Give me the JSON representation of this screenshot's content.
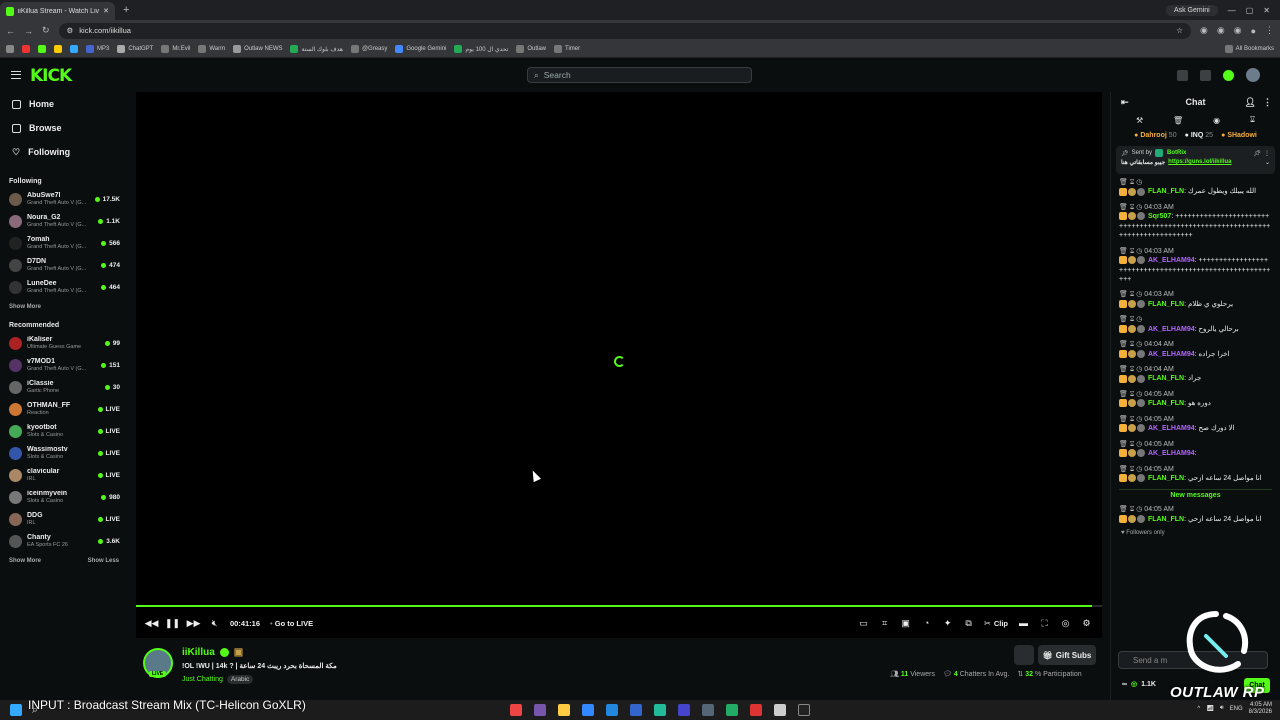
{
  "browser": {
    "tab_title": "iiKillua Stream - Watch Live on",
    "ask_gemini": "Ask Gemini",
    "url": "kick.com/iikillua",
    "bookmarks": [
      "MP3",
      "ChatGPT",
      "Mr.Evil",
      "Warm",
      "Outlaw NEWS",
      "هدف بلوك الستة",
      "@Greasy",
      "Google Gemini",
      "تحدي ال 100 يوم",
      "Outlaw",
      "Timer"
    ],
    "all_bookmarks": "All Bookmarks"
  },
  "header": {
    "logo": "KICK",
    "search_placeholder": "Search"
  },
  "sidebar": {
    "nav": [
      {
        "label": "Home",
        "icon": "home-icon"
      },
      {
        "label": "Browse",
        "icon": "browse-icon"
      },
      {
        "label": "Following",
        "icon": "heart-icon"
      }
    ],
    "following_heading": "Following",
    "following": [
      {
        "name": "AbuSwe7l",
        "category": "Grand Theft Auto V (G...",
        "viewers": "17.5K",
        "color": "#6b5a4a"
      },
      {
        "name": "Noura_G2",
        "category": "Grand Theft Auto V (G...",
        "viewers": "1.1K",
        "color": "#8a6a7a"
      },
      {
        "name": "7omah",
        "category": "Grand Theft Auto V (G...",
        "viewers": "566",
        "color": "#222222"
      },
      {
        "name": "D7DN",
        "category": "Grand Theft Auto V (G...",
        "viewers": "474",
        "color": "#444444"
      },
      {
        "name": "LuneDee",
        "category": "Grand Theft Auto V (G...",
        "viewers": "464",
        "color": "#333333"
      }
    ],
    "show_more": "Show More",
    "recommended_heading": "Recommended",
    "recommended": [
      {
        "name": "iKaliser",
        "category": "Ultimate Guess Game",
        "viewers": "99",
        "color": "#aa2222"
      },
      {
        "name": "v7MOD1",
        "category": "Grand Theft Auto V (G...",
        "viewers": "151",
        "color": "#553366"
      },
      {
        "name": "iClassie",
        "category": "Gartic Phone",
        "viewers": "30",
        "color": "#666666"
      },
      {
        "name": "OTHMAN_FF",
        "category": "Reaction",
        "viewers": "LIVE",
        "color": "#cc7733"
      },
      {
        "name": "kyootbot",
        "category": "Slots & Casino",
        "viewers": "LIVE",
        "color": "#44aa55"
      },
      {
        "name": "Wassimostv",
        "category": "Slots & Casino",
        "viewers": "LIVE",
        "color": "#3355aa"
      },
      {
        "name": "clavicular",
        "category": "IRL",
        "viewers": "LIVE",
        "color": "#aa8866"
      },
      {
        "name": "iceinmyvein",
        "category": "Slots & Casino",
        "viewers": "980",
        "color": "#777777"
      },
      {
        "name": "DDG",
        "category": "IRL",
        "viewers": "LIVE",
        "color": "#886655"
      },
      {
        "name": "Chanty",
        "category": "EA Sports FC 26",
        "viewers": "3.6K",
        "color": "#555555"
      }
    ],
    "show_less": "Show Less"
  },
  "player": {
    "progress": 0.99,
    "time": "00:41:16",
    "go_live": "Go to LIVE",
    "clip": "Clip"
  },
  "stream": {
    "streamer": "iiKillua",
    "live_badge": "LIVE",
    "title": "!OL !WU | 14k ? | مكة المسحاة بحرد ريبث 24 ساعة",
    "category": "Just Chatting",
    "tag": "Arabic",
    "gift_subs": "Gift Subs",
    "viewers_num": "11",
    "viewers_label": "Viewers",
    "chatters_num": "4",
    "chatters_label": "Chatters In Avg.",
    "participation_num": "32",
    "participation_label": "% Participation"
  },
  "chat": {
    "title": "Chat",
    "leaderboard": [
      {
        "name": "Dahrooj",
        "count": "50"
      },
      {
        "name": "INQ",
        "count": "25"
      },
      {
        "name": "SHadowi",
        "count": ""
      }
    ],
    "pinned_sender": "Sent by",
    "pinned_bot": "BotRix",
    "pinned_text": "جيبو مسابقاتي هنا",
    "pinned_url": "https://guns.lol/iikillua",
    "messages": [
      {
        "time": "",
        "user": "FLAN_FLN",
        "color": "#53fc18",
        "text": "الله يبيلك ويطول عمرك"
      },
      {
        "time": "04:03 AM",
        "user": "Sqr507",
        "color": "#53fc18",
        "text": "++++++++++++++++++++++++++++++++++++++++++++++++++++++++++++++++++++++++++++++"
      },
      {
        "time": "04:03 AM",
        "user": "AK_ELHAM94",
        "color": "#b366ff",
        "text": "+++++++++++++++++++++++++++++++++++++++++++++++++++++++++"
      },
      {
        "time": "04:03 AM",
        "user": "FLAN_FLN",
        "color": "#53fc18",
        "text": "يرحلوي ي ظلام"
      },
      {
        "time": "",
        "user": "AK_ELHAM94",
        "color": "#b366ff",
        "text": "برحالي يالروح"
      },
      {
        "time": "04:04 AM",
        "user": "AK_ELHAM94",
        "color": "#b366ff",
        "text": "اخرا جراده"
      },
      {
        "time": "04:04 AM",
        "user": "FLAN_FLN",
        "color": "#53fc18",
        "text": "جراد"
      },
      {
        "time": "04:05 AM",
        "user": "FLAN_FLN",
        "color": "#53fc18",
        "text": "دوره هو"
      },
      {
        "time": "04:05 AM",
        "user": "AK_ELHAM94",
        "color": "#b366ff",
        "text": "الا دورك صح"
      },
      {
        "time": "04:05 AM",
        "user": "AK_ELHAM94",
        "color": "#b366ff",
        "text": ""
      },
      {
        "time": "04:05 AM",
        "user": "FLAN_FLN",
        "color": "#53fc18",
        "text": "انا مواصل 24 ساعه ازحي"
      }
    ],
    "new_messages": "New messages",
    "after_new": {
      "time": "04:05 AM",
      "user": "FLAN_FLN",
      "color": "#53fc18",
      "text": "انا مواصل 24 ساعه ازحي"
    },
    "followers_only": "Followers only",
    "input_placeholder": "Send a m",
    "points": "1.1K",
    "chat_button": "Chat"
  },
  "overlay": {
    "brand": "OUTLAW RP",
    "ticker": "INPUT : Broadcast Stream Mix (TC-Helicon GoXLR)"
  },
  "taskbar": {
    "lang": "ENG",
    "time": "4:05 AM",
    "date": "8/3/2026"
  }
}
